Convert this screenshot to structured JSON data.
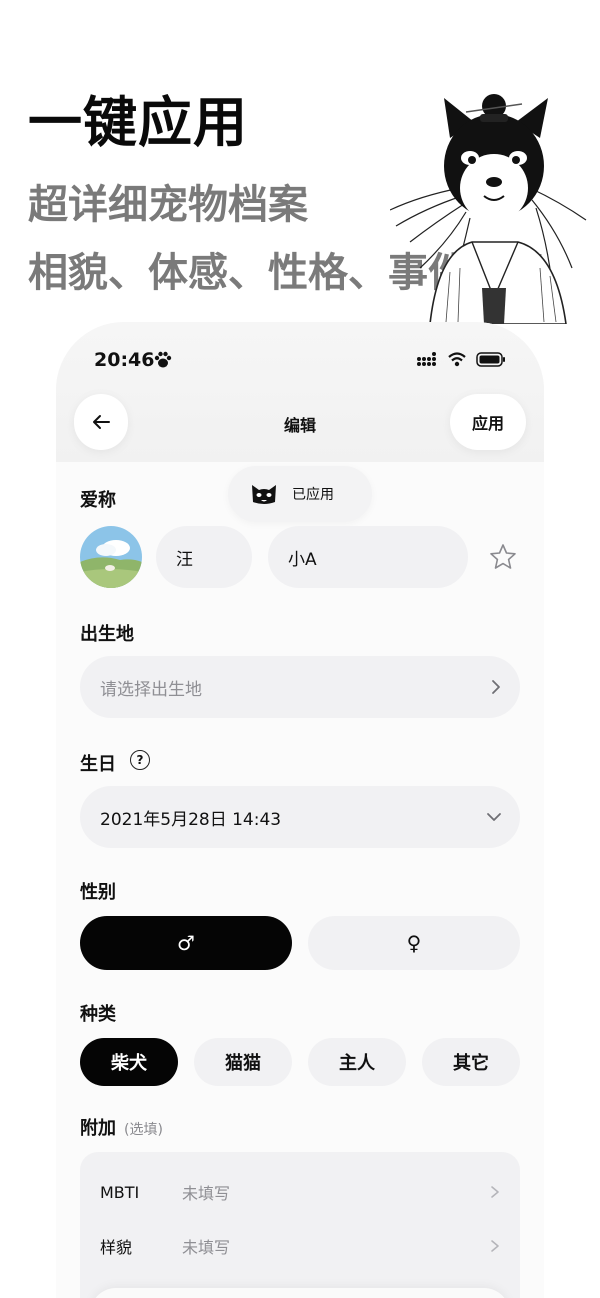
{
  "promo": {
    "title": "一键应用",
    "subtitle1": "超详细宠物档案",
    "subtitle2": "相貌、体感、性格、事件记录"
  },
  "status_bar": {
    "time": "20:46"
  },
  "nav": {
    "back_icon": "arrow-left-icon",
    "title": "编辑",
    "apply_label": "应用"
  },
  "toast": {
    "icon": "shiba-icon",
    "text": "已应用"
  },
  "form": {
    "nickname": {
      "label": "爱称",
      "surname": "汪",
      "name": "小A"
    },
    "birthplace": {
      "label": "出生地",
      "placeholder": "请选择出生地"
    },
    "birthday": {
      "label": "生日",
      "help": "?",
      "value": "2021年5月28日 14:43"
    },
    "gender": {
      "label": "性别",
      "male": "♂",
      "female": "♀",
      "selected": "male"
    },
    "species": {
      "label": "种类",
      "options": [
        "柴犬",
        "猫猫",
        "主人",
        "其它"
      ],
      "selected": "柴犬"
    },
    "extra": {
      "label": "附加",
      "hint": "(选填)",
      "rows": [
        {
          "key": "MBTI",
          "value": "未填写"
        },
        {
          "key": "样貌",
          "value": "未填写"
        }
      ]
    }
  },
  "colors": {
    "accent": "#050505",
    "field_bg": "#f1f1f3",
    "muted_text": "#8f8f94",
    "promo_gray": "#7a7a7a"
  }
}
